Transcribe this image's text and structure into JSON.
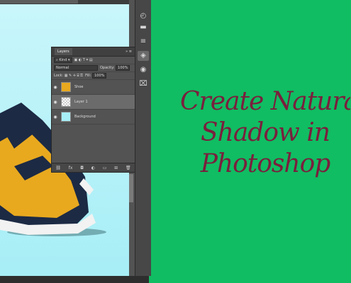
{
  "layers_panel": {
    "tab_label": "Layers",
    "filter_label": "Kind",
    "blend_mode": "Normal",
    "opacity_label": "Opacity:",
    "opacity_value": "100%",
    "lock_label": "Lock:",
    "fill_label": "Fill:",
    "fill_value": "100%",
    "layers": [
      {
        "name": "Shoe",
        "selected": false
      },
      {
        "name": "Layer 1",
        "selected": true
      },
      {
        "name": "Background",
        "selected": false
      }
    ],
    "footer_icons": [
      "link-icon",
      "fx-icon",
      "mask-icon",
      "adjustment-icon",
      "group-icon",
      "new-layer-icon",
      "trash-icon"
    ]
  },
  "title": {
    "line1": "Create Natural",
    "line2": "Shadow in",
    "line3": "Photoshop"
  },
  "colors": {
    "background": "#10bd62",
    "title": "#7a1f3d",
    "canvas": "#a7eef6",
    "panel": "#535353"
  }
}
